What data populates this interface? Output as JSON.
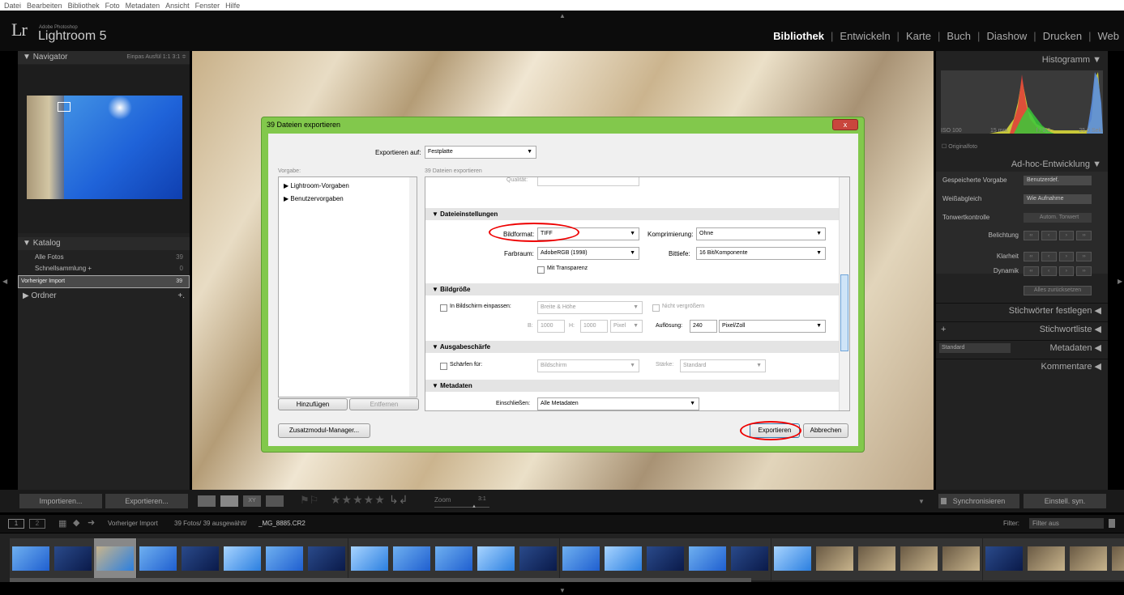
{
  "menubar": [
    "Datei",
    "Bearbeiten",
    "Bibliothek",
    "Foto",
    "Metadaten",
    "Ansicht",
    "Fenster",
    "Hilfe"
  ],
  "app": {
    "logo": "Lr",
    "vendor": "Adobe Photoshop",
    "name": "Lightroom 5"
  },
  "modules": [
    "Bibliothek",
    "Entwickeln",
    "Karte",
    "Buch",
    "Diashow",
    "Drucken",
    "Web"
  ],
  "navigator": {
    "title": "Navigator",
    "options": "Einpas  Ausfül  1:1  3:1 ≑"
  },
  "katalog": {
    "title": "Katalog",
    "items": [
      {
        "label": "Alle Fotos",
        "count": "39"
      },
      {
        "label": "Schnellsammlung +",
        "count": "0"
      },
      {
        "label": "Vorheriger Import",
        "count": "39"
      }
    ]
  },
  "ordner": {
    "title": "Ordner",
    "add": "+."
  },
  "right": {
    "histogramm": "Histogramm",
    "histo_info": [
      "ISO 100",
      "15 mm",
      "f / 9,0",
      "25,0 Sek."
    ],
    "originalfoto": "Originalfoto",
    "adhoc": "Ad-hoc-Entwicklung",
    "gespeicherte": "Gespeicherte Vorgabe",
    "gespeicherte_val": "Benutzerdef.",
    "weiss": "Weißabgleich",
    "weiss_val": "Wie Aufnahme",
    "tonwert": "Tonwertkontrolle",
    "tonwert_val": "Autom. Tonwert",
    "belichtung": "Belichtung",
    "klarheit": "Klarheit",
    "dynamik": "Dynamik",
    "reset": "Alles zurücksetzen",
    "stichwoerter": "Stichwörter festlegen",
    "stichwortliste": "Stichwortliste",
    "metadaten": "Metadaten",
    "metadaten_preset": "Standard",
    "kommentare": "Kommentare"
  },
  "bottom": {
    "importieren": "Importieren...",
    "exportieren": "Exportieren...",
    "zoom_label": "Zoom",
    "zoom_val": "3:1",
    "sync": "Synchronisieren",
    "einstell": "Einstell. syn."
  },
  "filmbar": {
    "source": "Vorheriger Import",
    "info": "39 Fotos/ 39 ausgewählt/",
    "file": "_MG_8885.CR2",
    "filter_label": "Filter:",
    "filter_val": "Filter aus"
  },
  "dialog": {
    "title": "39 Dateien exportieren",
    "close": "x",
    "export_to_label": "Exportieren auf:",
    "export_to": "Festplatte",
    "vorgabe": "Vorgabe:",
    "dateien": "39 Dateien exportieren",
    "presets": [
      "Lightroom-Vorgaben",
      "Benutzervorgaben"
    ],
    "add": "Hinzufügen",
    "remove": "Entfernen",
    "qualitaet": "Qualität:",
    "dateieinstellungen": "Dateieinstellungen",
    "bildformat_label": "Bildformat:",
    "bildformat": "TIFF",
    "komprimierung_label": "Komprimierung:",
    "komprimierung": "Ohne",
    "farbraum_label": "Farbraum:",
    "farbraum": "AdobeRGB (1998)",
    "bittiefe_label": "Bittiefe:",
    "bittiefe": "16 Bit/Komponente",
    "transparenz": "Mit Transparenz",
    "bildgroesse": "Bildgröße",
    "einpassen": "In Bildschirm einpassen:",
    "einpassen_val": "Breite & Höhe",
    "nicht_vergr": "Nicht vergrößern",
    "b_label": "B:",
    "b_val": "1000",
    "h_label": "H:",
    "h_val": "1000",
    "unit": "Pixel",
    "aufloesung_label": "Auflösung:",
    "aufloesung": "240",
    "aufloesung_unit": "Pixel/Zoll",
    "ausgabeschaerfe": "Ausgabeschärfe",
    "schaerfen": "Schärfen für:",
    "schaerfen_val": "Bildschirm",
    "staerke_label": "Stärke:",
    "staerke": "Standard",
    "metadaten": "Metadaten",
    "einschliessen_label": "Einschließen:",
    "einschliessen": "Alle Metadaten",
    "zusatz": "Zusatzmodul-Manager...",
    "exportieren": "Exportieren",
    "abbrechen": "Abbrechen"
  },
  "thumbs": [
    "blue",
    "navy",
    "tan-sel",
    "blue",
    "navy",
    "sky",
    "blue",
    "navy",
    "sky",
    "blue",
    "blue",
    "sky",
    "navy",
    "blue",
    "sky",
    "navy",
    "blue",
    "navy",
    "sky",
    "tan",
    "tan",
    "tan",
    "tan",
    "navy",
    "tan",
    "tan",
    "tan"
  ]
}
